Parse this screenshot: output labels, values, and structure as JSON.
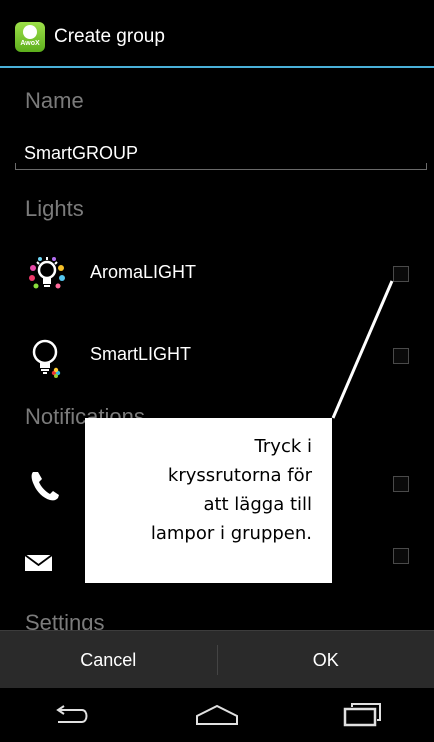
{
  "titlebar": {
    "app_icon_text": "AwoX",
    "title": "Create group"
  },
  "form": {
    "name_header": "Name",
    "name_value": "SmartGROUP",
    "lights_header": "Lights",
    "notifications_header": "Notifications",
    "settings_header": "Settings"
  },
  "lights": [
    {
      "label": "AromaLIGHT",
      "icon": "aroma-bulb-icon",
      "checked": false
    },
    {
      "label": "SmartLIGHT",
      "icon": "smart-bulb-icon",
      "checked": false
    }
  ],
  "notifications": [
    {
      "icon": "phone-icon",
      "checked": false
    },
    {
      "icon": "envelope-icon",
      "checked": false
    }
  ],
  "buttons": {
    "cancel": "Cancel",
    "ok": "OK"
  },
  "navigation": {
    "back": "back-icon",
    "home": "home-icon",
    "recents": "recents-icon"
  },
  "callout": {
    "lines": [
      "Tryck i",
      "kryssrutorna för",
      "att lägga till",
      "lampor i gruppen."
    ]
  }
}
